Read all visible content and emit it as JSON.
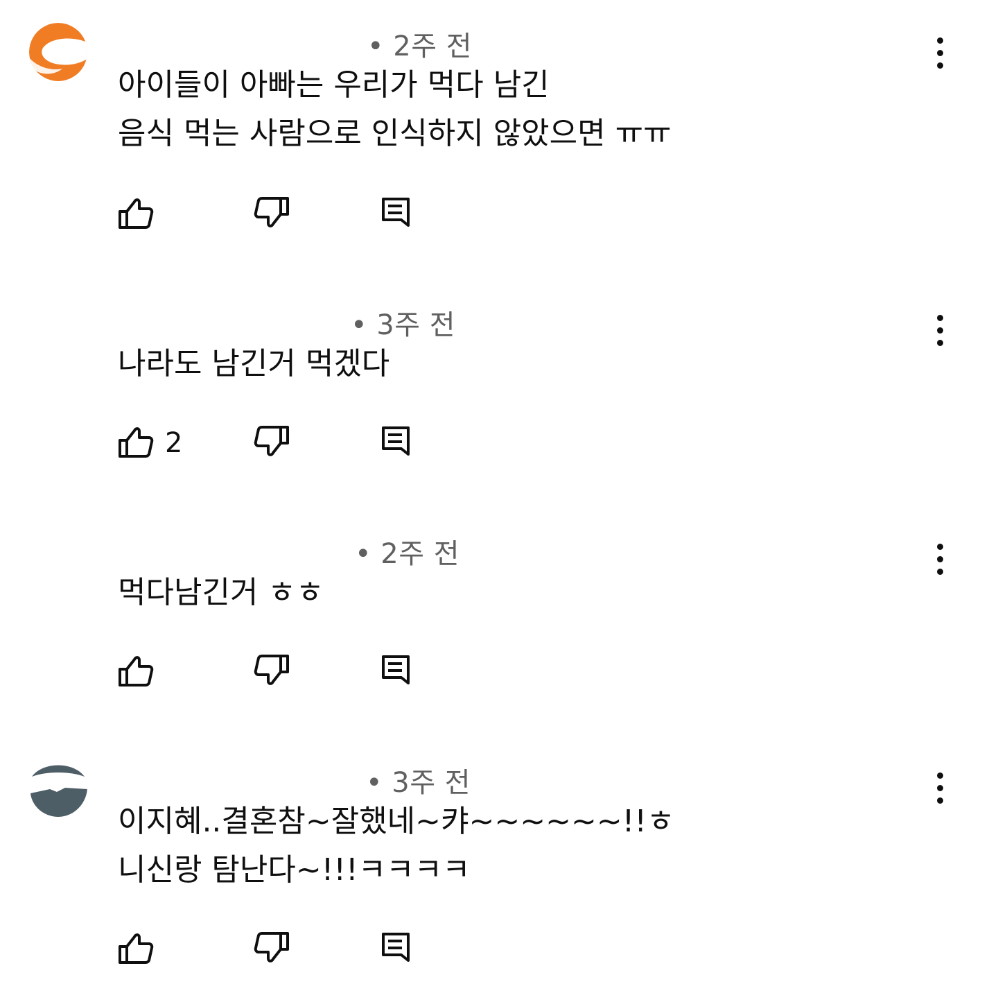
{
  "comments": [
    {
      "author": "",
      "time": "• 2주 전",
      "lines": [
        "아이들이 아빠는 우리가 먹다 남긴",
        "음식 먹는 사람으로 인식하지 않았으면 ㅠㅠ"
      ],
      "likes": "",
      "avatar_color": "#f07d24",
      "avatar_icon": "orange-logo-avatar"
    },
    {
      "author": "",
      "time": "• 3주 전",
      "lines": [
        "나라도 남긴거 먹겠다"
      ],
      "likes": "2",
      "avatar_color": "#ffffff",
      "avatar_icon": "blank-avatar"
    },
    {
      "author": "",
      "time": "• 2주 전",
      "lines": [
        "먹다남긴거 ㅎㅎ"
      ],
      "likes": "",
      "avatar_color": "#ffffff",
      "avatar_icon": "blank-avatar"
    },
    {
      "author": "",
      "time": "• 3주 전",
      "lines": [
        "이지혜..결혼참~잘했네~캬~~~~~~!!ㅎ",
        "니신랑 탐난다~!!!ㅋㅋㅋㅋ"
      ],
      "likes": "",
      "avatar_color": "#4e5e66",
      "avatar_icon": "landscape-avatar"
    }
  ],
  "icons": {
    "like": "thumbs-up-icon",
    "dislike": "thumbs-down-icon",
    "reply": "reply-comment-icon",
    "more": "more-vertical-icon"
  },
  "colors": {
    "text": "#0f0f0f",
    "meta": "#606060",
    "background": "#ffffff"
  }
}
